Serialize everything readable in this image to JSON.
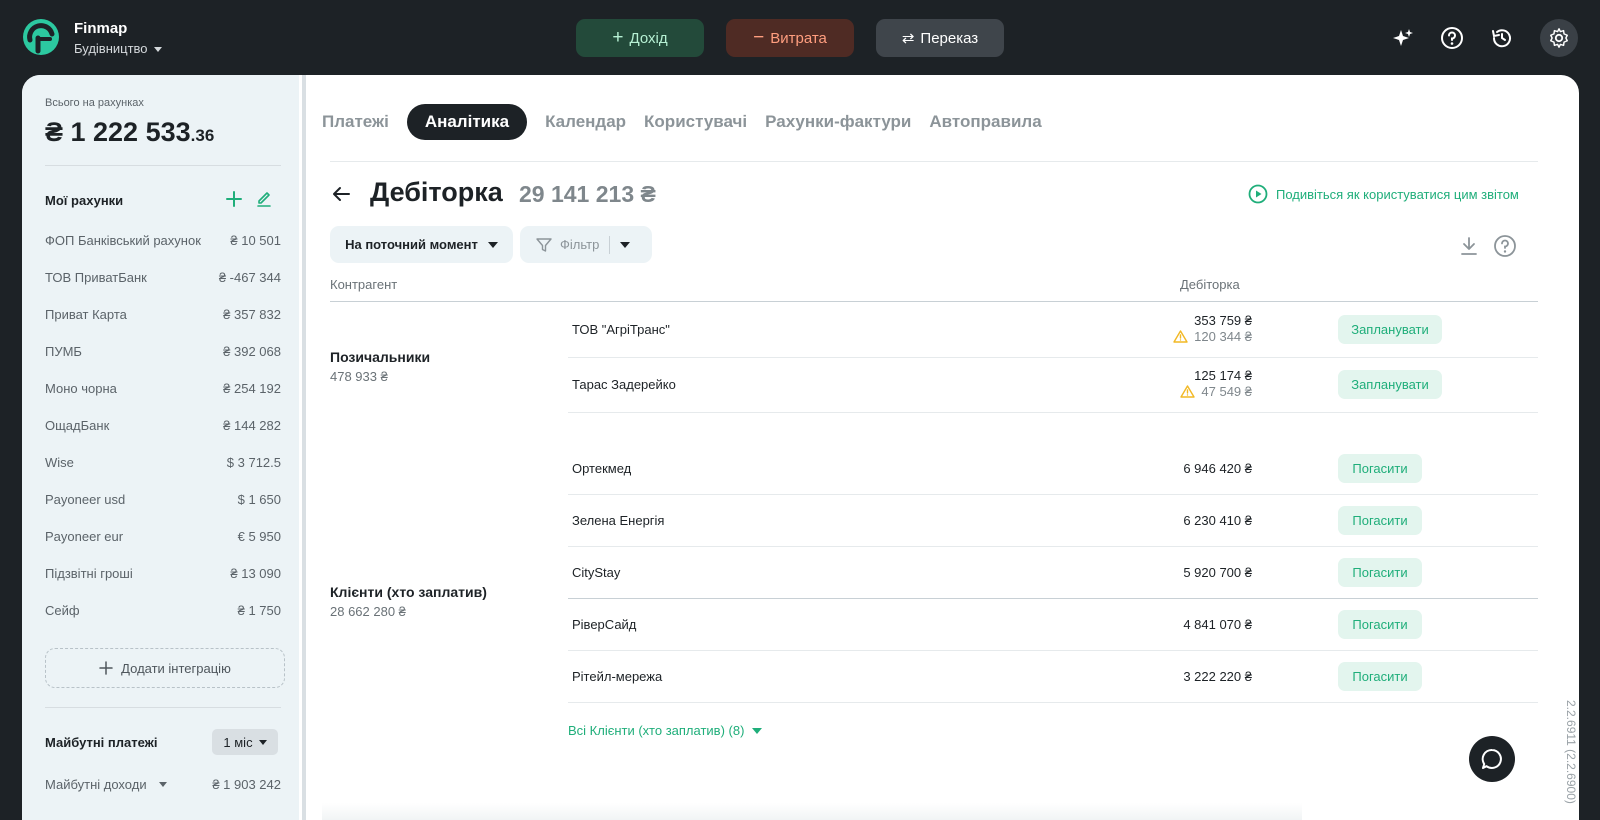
{
  "header": {
    "brand_name": "Finmap",
    "workspace": "Будівництво",
    "income_label": "Дохід",
    "expense_label": "Витрата",
    "transfer_label": "Переказ",
    "colors": {
      "bg": "#1d2226",
      "income_bg": "#234a3a",
      "expense_bg": "#4f2b24",
      "accent": "#1fae7a"
    }
  },
  "sidebar": {
    "total_label": "Всього на рахунках",
    "total_main": "₴ 1 222 533",
    "total_decimal": ".36",
    "accounts_title": "Мої рахунки",
    "accounts": [
      {
        "name": "ФОП Банківський рахунок",
        "amount": "₴ 10 501"
      },
      {
        "name": "ТОВ ПриватБанк",
        "amount": "₴ -467 344"
      },
      {
        "name": "Приват Карта",
        "amount": "₴ 357 832"
      },
      {
        "name": "ПУМБ",
        "amount": "₴ 392 068"
      },
      {
        "name": "Моно чорна",
        "amount": "₴ 254 192"
      },
      {
        "name": "ОщадБанк",
        "amount": "₴ 144 282"
      },
      {
        "name": "Wise",
        "amount": "$ 3 712.5"
      },
      {
        "name": "Payoneer usd",
        "amount": "$ 1 650"
      },
      {
        "name": "Payoneer eur",
        "amount": "€ 5 950"
      },
      {
        "name": "Підзвітні гроші",
        "amount": "₴ 13 090"
      },
      {
        "name": "Сейф",
        "amount": "₴ 1 750"
      }
    ],
    "add_integration_label": "Додати інтеграцію",
    "future_title": "Майбутні платежі",
    "future_period": "1 міс",
    "future_income_label": "Майбутні доходи",
    "future_income_amount": "₴ 1 903 242"
  },
  "tabs": [
    {
      "label": "Платежі",
      "active": false
    },
    {
      "label": "Аналітика",
      "active": true
    },
    {
      "label": "Календар",
      "active": false
    },
    {
      "label": "Користувачі",
      "active": false
    },
    {
      "label": "Рахунки-фактури",
      "active": false
    },
    {
      "label": "Автоправила",
      "active": false
    }
  ],
  "report": {
    "title": "Дебіторка",
    "total": "29 141 213 ₴",
    "help_link": "Подивіться як користуватися цим звітом",
    "moment_select": "На поточний момент",
    "filter_label": "Фільтр",
    "col_counterparty": "Контрагент",
    "col_receivable": "Дебіторка",
    "groups": [
      {
        "name": "Позичальники",
        "sum": "478 933 ₴",
        "rows": [
          {
            "name": "ТОВ \"АгріТранс\"",
            "amount": "353 759 ₴",
            "overdue": "120 344 ₴",
            "action": "Запланувати"
          },
          {
            "name": "Тарас Задерейко",
            "amount": "125 174 ₴",
            "overdue": "47 549 ₴",
            "action": "Запланувати"
          }
        ]
      },
      {
        "name": "Клієнти (хто заплатив)",
        "sum": "28 662 280 ₴",
        "rows": [
          {
            "name": "Ортекмед",
            "amount": "6 946 420 ₴",
            "action": "Погасити"
          },
          {
            "name": "Зелена Енергія",
            "amount": "6 230 410 ₴",
            "action": "Погасити"
          },
          {
            "name": "CityStay",
            "amount": "5 920 700 ₴",
            "action": "Погасити"
          },
          {
            "name": "РіверСайд",
            "amount": "4 841 070 ₴",
            "action": "Погасити"
          },
          {
            "name": "Рітейл-мережа",
            "amount": "3 222 220 ₴",
            "action": "Погасити"
          }
        ],
        "show_all": "Всі Клієнти (хто заплатив) (8)"
      }
    ]
  },
  "version": "2.2.6911 (2.2.6900)"
}
